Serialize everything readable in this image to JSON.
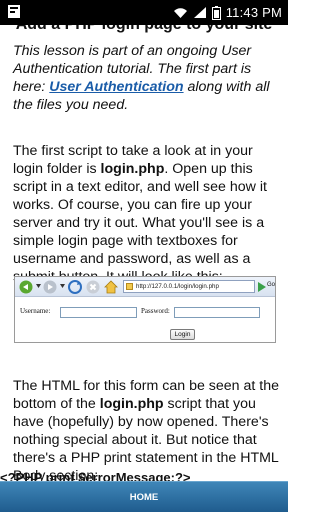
{
  "status_bar": {
    "time": "11:43 PM",
    "icons": [
      "notification-icon",
      "wifi-icon",
      "signal-icon",
      "battery-icon"
    ]
  },
  "article": {
    "title_cut": "Add a PHP login page to your site",
    "intro_text": "This lesson is part of an ongoing User Authentication tutorial. The first part is here: ",
    "intro_link": "User Authentication",
    "intro_after": " along with all the files you need.",
    "para2_a": "The first script to take a look at in your login folder is ",
    "para2_b": "login.php",
    "para2_c": ". Open up this script in a text editor, and well see how it works. Of course, you can fire up your server and try it out. What you'll see is a simple login page with textboxes for username and password, as well as a submit button. It will look like this:",
    "para3_a": "The HTML for this form can be seen at the bottom of the ",
    "para3_b": "login.php",
    "para3_c": " script that you have (hopefully) by now opened. There's nothing special about it. But notice that there's a PHP print statement in the HTML Body section:",
    "code_line": "<?PHP print $errorMessage;?>"
  },
  "screenshot": {
    "address": "http://127.0.0.1/login/login.php",
    "go_label": "Go",
    "username_label": "Username:",
    "password_label": "Password:",
    "login_button": "Login"
  },
  "bottom_bar": {
    "home_label": "HOME"
  },
  "colors": {
    "link": "#1a5ca8",
    "bottom_bar": "#2a6ea0",
    "status_bar": "#000000"
  }
}
